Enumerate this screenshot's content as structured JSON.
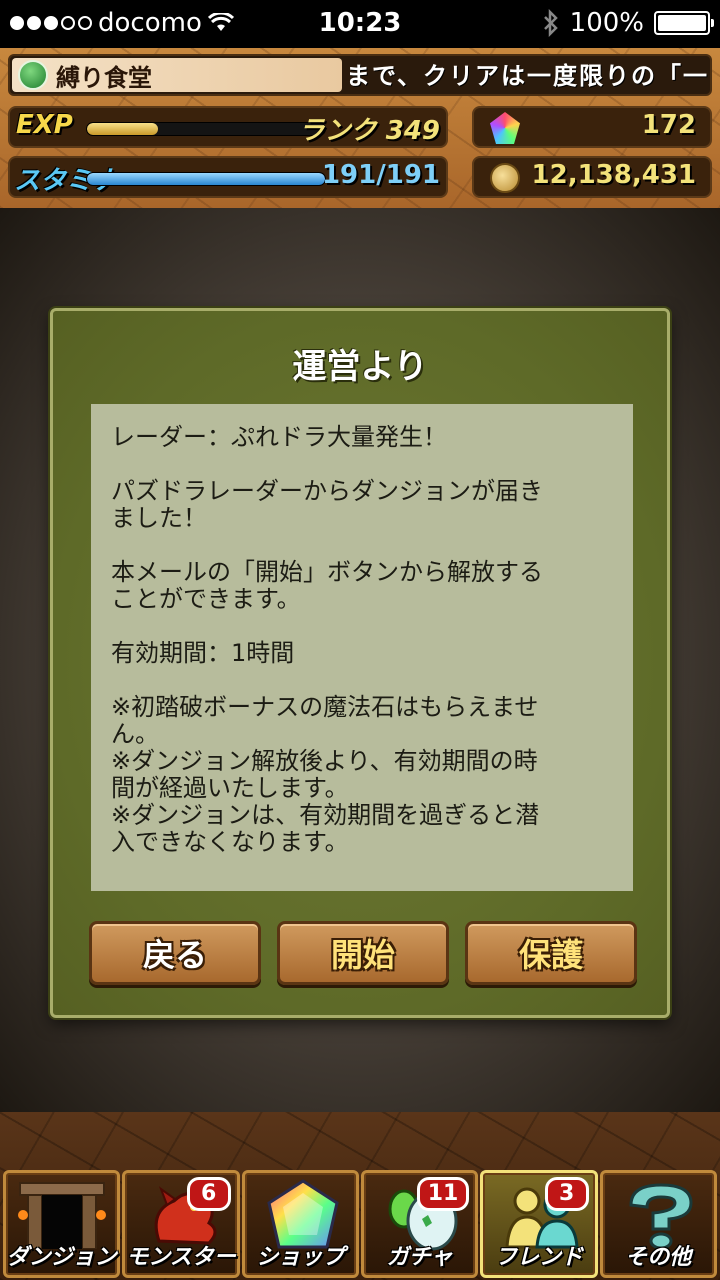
{
  "status_bar": {
    "carrier": "docomo",
    "time": "10:23",
    "battery": "100%"
  },
  "header": {
    "dungeon_name": "縛り食堂",
    "ticker": "まで、クリアは一度限りの「一|",
    "exp_label": "EXP",
    "exp_fraction": 0.3,
    "rank": "ランク 349",
    "stamina_label": "スタミナ",
    "stamina_value": "191/191",
    "stamina_fraction": 1.0,
    "magic_stones": "172",
    "coins": "12,138,431"
  },
  "dialog": {
    "title": "運営より",
    "lines": [
      "レーダー：ぷれドラ大量発生！",
      "",
      "パズドラレーダーからダンジョンが届き",
      "ました！",
      "",
      "本メールの「開始」ボタンから解放する",
      "ことができます。",
      "",
      "有効期間：1時間",
      "",
      "※初踏破ボーナスの魔法石はもらえませ",
      "ん。",
      "※ダンジョン解放後より、有効期間の時",
      "間が経過いたします。",
      "※ダンジョンは、有効期間を過ぎると潜",
      "入できなくなります。"
    ],
    "buttons": {
      "back": "戻る",
      "start": "開始",
      "protect": "保護"
    }
  },
  "nav": {
    "dungeon": "ダンジョン",
    "monster": "モンスター",
    "monster_badge": "6",
    "shop": "ショップ",
    "gacha": "ガチャ",
    "gacha_badge": "11",
    "friend": "フレンド",
    "friend_badge": "3",
    "other": "その他"
  },
  "colors": {
    "exp_bar": "#e8c25a",
    "stamina_bar": "#4aa6e8",
    "exp_label": "#f7d84a",
    "stamina_label": "#5ac8f5",
    "value_yellow": "#f3e27a",
    "value_blue": "#7ecff7"
  }
}
